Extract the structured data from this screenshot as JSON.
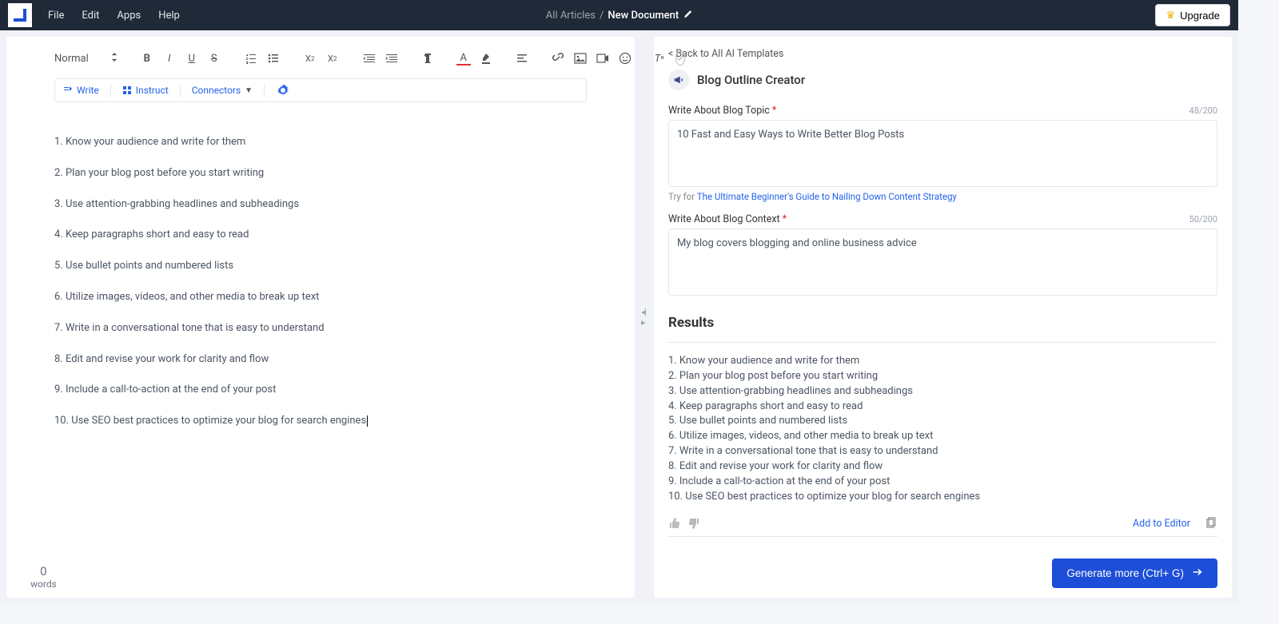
{
  "header": {
    "menu": {
      "file": "File",
      "edit": "Edit",
      "apps": "Apps",
      "help": "Help"
    },
    "breadcrumb": {
      "root": "All Articles",
      "sep": "/",
      "doc": "New Document"
    },
    "upgrade": "Upgrade"
  },
  "toolbar": {
    "styleSelect": "Normal",
    "write": "Write",
    "instruct": "Instruct",
    "connectors": "Connectors"
  },
  "editor": {
    "lines": [
      "1. Know your audience and write for them",
      "2. Plan your blog post before you start writing",
      "3. Use attention-grabbing headlines and subheadings",
      "4. Keep paragraphs short and easy to read",
      "5. Use bullet points and numbered lists",
      "6. Utilize images, videos, and other media to break up text",
      "7. Write in a conversational tone that is easy to understand",
      "8. Edit and revise your work for clarity and flow",
      "9. Include a call-to-action at the end of your post",
      "10. Use SEO best practices to optimize your blog for search engines"
    ]
  },
  "wordCount": {
    "num": "0",
    "label": "words"
  },
  "right": {
    "backLink": "< Back to All AI Templates",
    "templateName": "Blog Outline Creator",
    "topic": {
      "label": "Write About Blog Topic",
      "counter": "48/200",
      "value": "10 Fast and Easy Ways to Write Better Blog Posts",
      "tryPrefix": "Try for ",
      "tryLink": "The Ultimate Beginner's Guide to Nailing Down Content Strategy"
    },
    "context": {
      "label": "Write About Blog Context",
      "counter": "50/200",
      "value": "My blog covers blogging and online business advice"
    },
    "resultsHeader": "Results",
    "results": [
      "1. Know your audience and write for them",
      "2. Plan your blog post before you start writing",
      "3. Use attention-grabbing headlines and subheadings",
      "4. Keep paragraphs short and easy to read",
      "5. Use bullet points and numbered lists",
      "6. Utilize images, videos, and other media to break up text",
      "7. Write in a conversational tone that is easy to understand",
      "8. Edit and revise your work for clarity and flow",
      "9. Include a call-to-action at the end of your post",
      "10. Use SEO best practices to optimize your blog for search engines"
    ],
    "addToEditor": "Add to Editor",
    "generate": "Generate more (Ctrl+ G)"
  }
}
